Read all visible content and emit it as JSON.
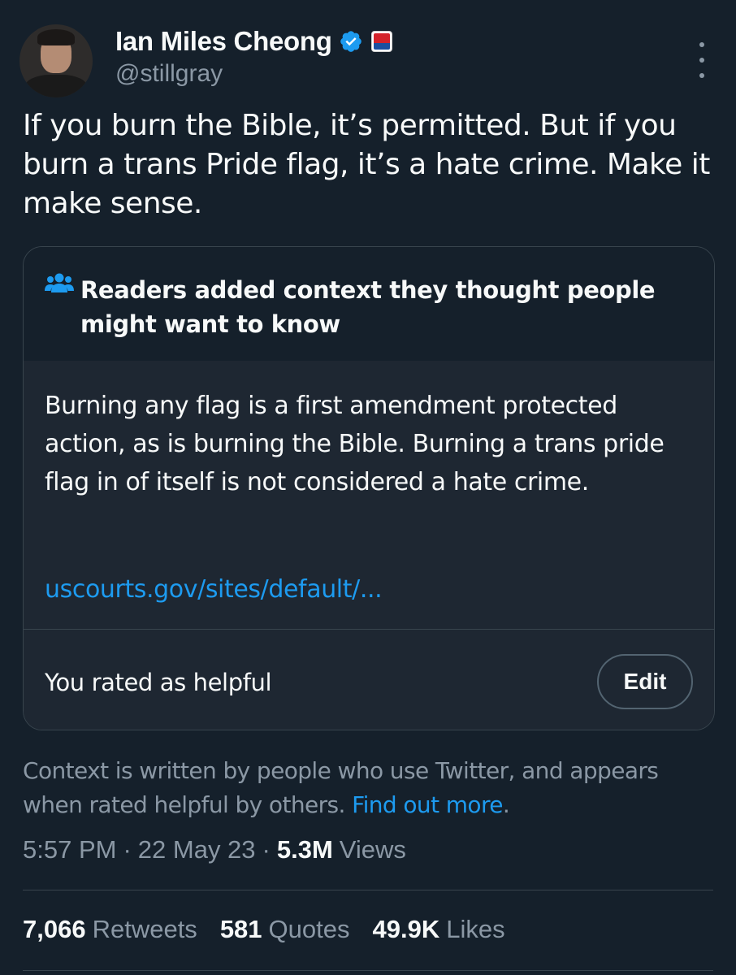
{
  "author": {
    "display_name": "Ian Miles Cheong",
    "handle": "@stillgray",
    "verified_icon": "verified-badge-icon",
    "affiliate_badge": "news-affiliate-badge"
  },
  "tweet": {
    "text": "If you burn the Bible, it’s permitted. But if you burn a trans Pride flag, it’s a hate crime. Make it make sense."
  },
  "community_note": {
    "icon": "people-group-icon",
    "title": "Readers added context they thought people might want to know",
    "body": "Burning any flag is a first amendment protected action, as is burning the Bible. Burning a trans pride flag in of itself is not considered a hate crime.",
    "link": "uscourts.gov/sites/default/...",
    "rating_status": "You rated as helpful",
    "edit_label": "Edit"
  },
  "disclaimer": {
    "text": "Context is written by people who use Twitter, and appears when rated helpful by others.",
    "link": "Find out more",
    "trail": "."
  },
  "meta": {
    "time": "5:57 PM",
    "date": "22 May 23",
    "separator": "·",
    "views_count": "5.3M",
    "views_label": "Views"
  },
  "stats": {
    "retweets_count": "7,066",
    "retweets_label": "Retweets",
    "quotes_count": "581",
    "quotes_label": "Quotes",
    "likes_count": "49.9K",
    "likes_label": "Likes"
  },
  "colors": {
    "background": "#15202b",
    "note_background": "#1e2732",
    "text_primary": "#f7f9f9",
    "text_secondary": "#8b98a5",
    "accent": "#1d9bf0",
    "border": "#38444d"
  }
}
